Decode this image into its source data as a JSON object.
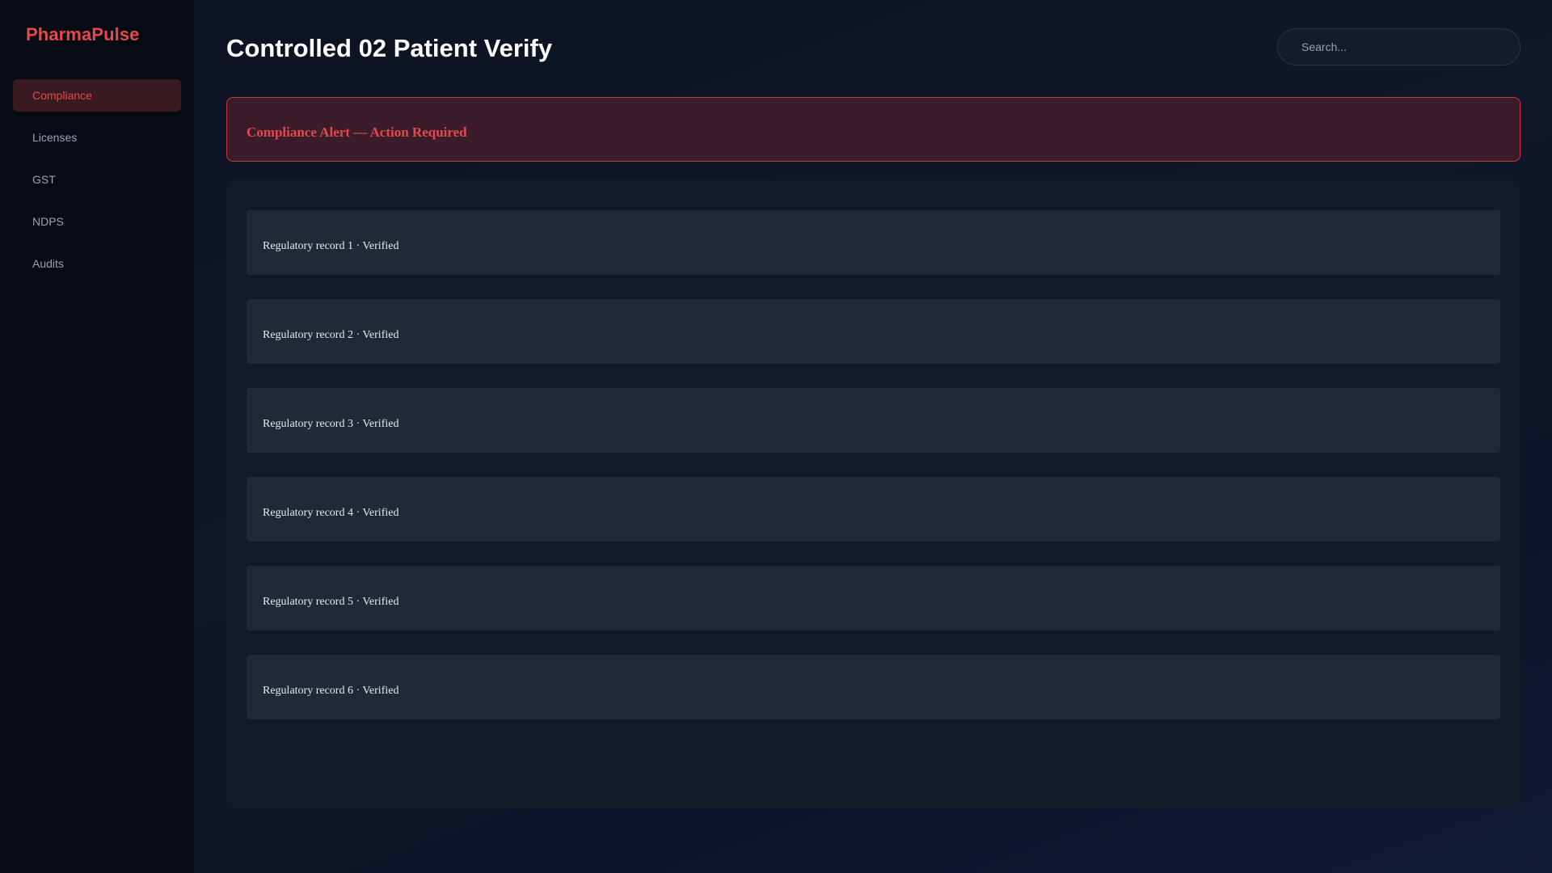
{
  "app": {
    "brand": "PharmaPulse"
  },
  "sidebar": {
    "items": [
      {
        "label": "Compliance",
        "active": true
      },
      {
        "label": "Licenses",
        "active": false
      },
      {
        "label": "GST",
        "active": false
      },
      {
        "label": "NDPS",
        "active": false
      },
      {
        "label": "Audits",
        "active": false
      }
    ]
  },
  "header": {
    "title": "Controlled 02 Patient Verify",
    "search_placeholder": "Search..."
  },
  "alert": {
    "text": "Compliance Alert — Action Required"
  },
  "records": [
    {
      "text": "Regulatory record 1 · Verified"
    },
    {
      "text": "Regulatory record 2 · Verified"
    },
    {
      "text": "Regulatory record 3 · Verified"
    },
    {
      "text": "Regulatory record 4 · Verified"
    },
    {
      "text": "Regulatory record 5 · Verified"
    },
    {
      "text": "Regulatory record 6 · Verified"
    }
  ],
  "colors": {
    "accent": "#e5484d",
    "sidebar_bg": "#070b14",
    "alert_bg": "#3a1c2b",
    "record_bg": "#202938"
  }
}
